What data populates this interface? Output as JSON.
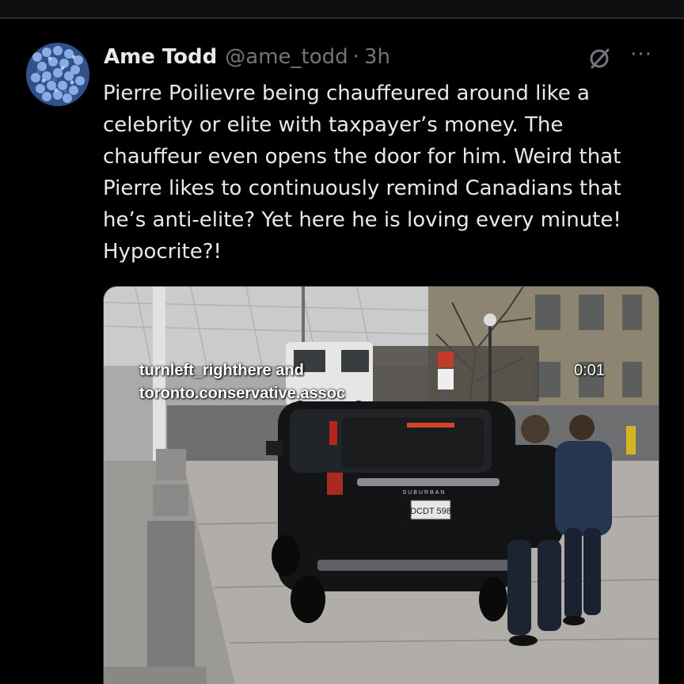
{
  "tweet": {
    "author_name": "Ame Todd",
    "author_handle": "@ame_todd",
    "separator": "·",
    "time": "3h",
    "text": "Pierre Poilievre being chauffeured around like a\ncelebrity or elite with taxpayer’s money. The\nchauffeur even opens the door for him. Weird that\nPierre likes to continuously remind Canadians that\nhe’s anti-elite? Yet here he is loving every minute!\nHypocrite?!",
    "avatar_icon": "hydrangea-flower-avatar"
  },
  "actions": {
    "grok_icon": "grok-icon",
    "more_icon": "more-options-icon",
    "more_glyph": "···"
  },
  "media": {
    "overlay_caption": "turnleft_righthere and\ntoronto.conservative.assoc",
    "video_time": "0:01",
    "license_plate": "DCDT 598",
    "badge": "SUBURBAN"
  },
  "colors": {
    "background": "#000000",
    "text": "#e7e9ea",
    "secondary_text": "#71767b"
  }
}
